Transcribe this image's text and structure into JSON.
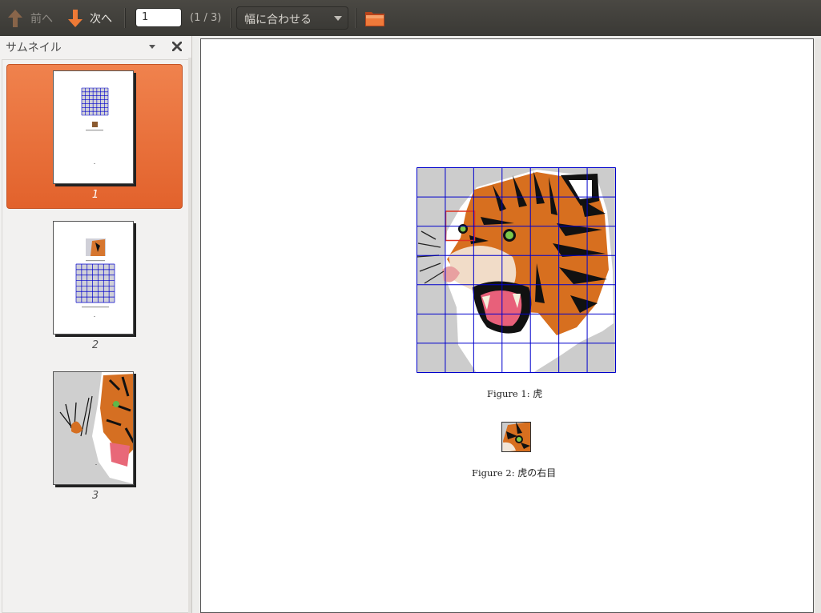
{
  "toolbar": {
    "prev_label": "前へ",
    "next_label": "次へ",
    "page_value": "1",
    "page_count": "(1 / 3)",
    "zoom_label": "幅に合わせる",
    "icons": {
      "prev": "arrow-up-icon",
      "next": "arrow-down-icon",
      "zoom_dropdown": "dropdown-arrow-icon",
      "open": "folder-icon"
    }
  },
  "sidebar": {
    "title": "サムネイル",
    "icons": {
      "dropdown": "dropdown-arrow-icon",
      "close": "close-icon"
    },
    "thumbnails": [
      {
        "number": "1",
        "selected": true
      },
      {
        "number": "2",
        "selected": false
      },
      {
        "number": "3",
        "selected": false
      }
    ]
  },
  "document": {
    "figure1": {
      "label": "Figure 1:",
      "text": "虎"
    },
    "figure2": {
      "label": "Figure 2:",
      "text": "虎の右目"
    }
  },
  "colors": {
    "toolbar": "#3c3b37",
    "accent": "#e8672f",
    "grid_line": "#0000cc",
    "highlight": "#dd3322"
  }
}
